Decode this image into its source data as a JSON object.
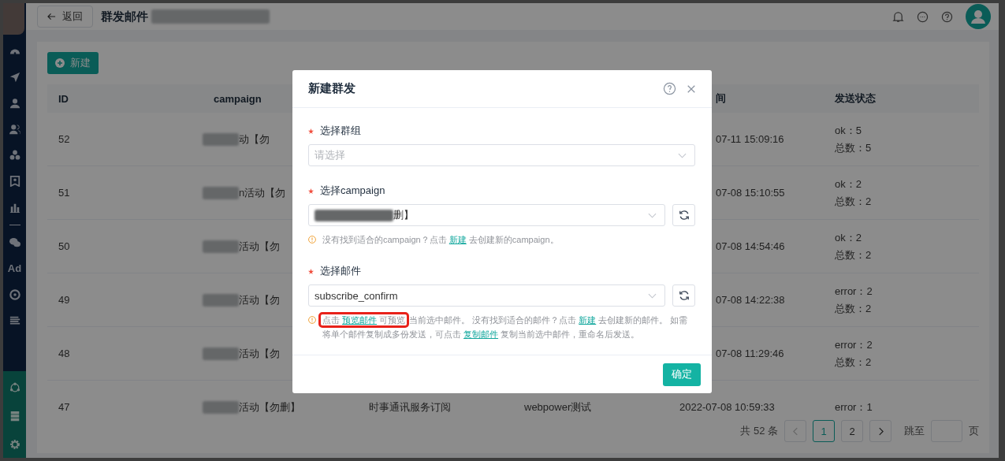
{
  "header": {
    "back_button": "返回",
    "title": "群发邮件"
  },
  "sidebar": {
    "ad_label": "Ad"
  },
  "toolbar": {
    "new_button": "新建"
  },
  "table": {
    "columns": [
      "ID",
      "campaign",
      "间",
      "发送状态"
    ],
    "rows": [
      {
        "id": "52",
        "campaign": "动【勿",
        "time": "07-11 15:09:16",
        "status": [
          "ok：5",
          "总数：5"
        ]
      },
      {
        "id": "51",
        "campaign": "n活动【勿",
        "time": "07-08 15:10:55",
        "status": [
          "ok：2",
          "总数：2"
        ]
      },
      {
        "id": "50",
        "campaign": "活动【勿",
        "time": "07-08 14:54:46",
        "status": [
          "ok：2",
          "总数：2"
        ]
      },
      {
        "id": "49",
        "campaign": "活动【勿",
        "time": "07-08 14:22:38",
        "status": [
          "error：2",
          "总数：2"
        ]
      },
      {
        "id": "48",
        "campaign": "活动【勿",
        "time": "07-08 11:29:46",
        "status": [
          "error：2",
          "总数：2"
        ]
      },
      {
        "id": "47",
        "campaign": "活动【勿删】",
        "column_3": "时事通讯服务订阅",
        "column_4": "webpower测试",
        "time": "2022-07-08 10:59:33",
        "status": [
          "error：1"
        ]
      }
    ]
  },
  "pagination": {
    "total": "共 52 条",
    "pages": [
      {
        "label": "1",
        "selected": true
      },
      {
        "label": "2",
        "selected": false
      }
    ],
    "jump_label": "跳至",
    "page_label": "页"
  },
  "dialog": {
    "title": "新建群发",
    "fields": [
      {
        "label": "选择群组",
        "required": true,
        "placeholder": "请选择",
        "refresh": false
      },
      {
        "label": "选择campaign",
        "required": true,
        "value": "删】",
        "redacted": true,
        "refresh": true,
        "hint": [
          {
            "annotated": false,
            "parts": [
              {
                "text": "没有找到适合的campaign？点击 ",
                "link": false
              },
              {
                "text": "新建",
                "link": true
              },
              {
                "text": " 去创建新的campaign。",
                "link": false
              }
            ]
          }
        ]
      },
      {
        "label": "选择邮件",
        "required": true,
        "value": "subscribe_confirm",
        "redacted": false,
        "refresh": true,
        "hint": [
          {
            "annotated": true,
            "parts": [
              {
                "text": "点击 ",
                "link": false
              },
              {
                "text": "预览邮件",
                "link": true
              },
              {
                "text": " 可预览",
                "link": false
              }
            ]
          },
          {
            "annotated": false,
            "parts": [
              {
                "text": "当前选中邮件。 没有找到适合的邮件？点击 ",
                "link": false
              },
              {
                "text": "新建",
                "link": true
              },
              {
                "text": " 去创建新的邮件。 如需将单个邮件复制成多份发送，可点击 ",
                "link": false
              },
              {
                "text": "复制邮件",
                "link": true
              },
              {
                "text": " 复制当前选中邮件，重命名后发送。",
                "link": false
              }
            ]
          }
        ]
      }
    ],
    "confirm_button": "确定"
  }
}
